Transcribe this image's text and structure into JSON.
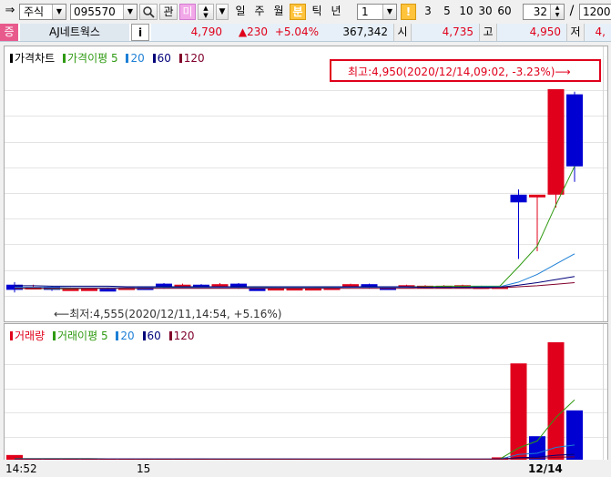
{
  "toolbar": {
    "market_select": "주식",
    "code_value": "095570",
    "btn_gwan": "관",
    "btn_ma": "미",
    "periods": [
      "일",
      "주",
      "월",
      "분",
      "틱",
      "년"
    ],
    "active_period": "분",
    "interval_value": "1",
    "interval_mark": "!",
    "intervals": [
      "3",
      "5",
      "10",
      "30",
      "60"
    ],
    "count_value": "32",
    "count_sep": "/",
    "count_total": "1200"
  },
  "quote": {
    "badge": "증",
    "name": "AJ네트웍스",
    "info": "i",
    "price": "4,790",
    "change": "▲230",
    "change_pct": "+5.04%",
    "volume": "367,342",
    "open_label": "시",
    "open_value": "4,735",
    "high_label": "고",
    "high_value": "4,950",
    "low_label": "저",
    "low_value": "4,"
  },
  "price_panel": {
    "legend_title": "가격차트",
    "legend_ma": "가격이평",
    "ma_periods": [
      "5",
      "20",
      "60",
      "120"
    ],
    "annotation_high": "최고:4,950(2020/12/14,09:02, -3.23%)⟶",
    "annotation_low": "⟵최저:4,555(2020/12/11,14:54, +5.16%)"
  },
  "volume_panel": {
    "legend_title": "거래량",
    "legend_ma": "거래이평",
    "ma_periods": [
      "5",
      "20",
      "60",
      "120"
    ]
  },
  "x_axis": {
    "labels": [
      "14:52",
      "15",
      "12/14"
    ]
  },
  "colors": {
    "up": "#e0001b",
    "down": "#0000d2",
    "ma5": "#2f9a12",
    "ma20": "#1d7fd6",
    "ma60": "#00007a",
    "ma120": "#80002a",
    "accent": "#ffc33c"
  },
  "chart_data": [
    {
      "type": "candlestick",
      "title": "가격차트",
      "y_range": [
        4520,
        4980
      ],
      "candles": [
        {
          "o": 4570,
          "h": 4575,
          "l": 4555,
          "c": 4560
        },
        {
          "o": 4565,
          "h": 4570,
          "l": 4562,
          "c": 4566
        },
        {
          "o": 4566,
          "h": 4567,
          "l": 4558,
          "c": 4560
        },
        {
          "o": 4562,
          "h": 4565,
          "l": 4560,
          "c": 4563
        },
        {
          "o": 4563,
          "h": 4564,
          "l": 4562,
          "c": 4563
        },
        {
          "o": 4562,
          "h": 4565,
          "l": 4560,
          "c": 4561
        },
        {
          "o": 4561,
          "h": 4566,
          "l": 4560,
          "c": 4565
        },
        {
          "o": 4565,
          "h": 4566,
          "l": 4560,
          "c": 4564
        },
        {
          "o": 4572,
          "h": 4573,
          "l": 4562,
          "c": 4566
        },
        {
          "o": 4566,
          "h": 4572,
          "l": 4565,
          "c": 4570
        },
        {
          "o": 4570,
          "h": 4571,
          "l": 4568,
          "c": 4569
        },
        {
          "o": 4566,
          "h": 4573,
          "l": 4565,
          "c": 4571
        },
        {
          "o": 4572,
          "h": 4573,
          "l": 4562,
          "c": 4563
        },
        {
          "o": 4563,
          "h": 4566,
          "l": 4558,
          "c": 4558
        },
        {
          "o": 4563,
          "h": 4565,
          "l": 4562,
          "c": 4564
        },
        {
          "o": 4564,
          "h": 4565,
          "l": 4563,
          "c": 4564
        },
        {
          "o": 4564,
          "h": 4565,
          "l": 4563,
          "c": 4564
        },
        {
          "o": 4564,
          "h": 4566,
          "l": 4563,
          "c": 4565
        },
        {
          "o": 4566,
          "h": 4572,
          "l": 4565,
          "c": 4571
        },
        {
          "o": 4571,
          "h": 4572,
          "l": 4563,
          "c": 4564
        },
        {
          "o": 4565,
          "h": 4566,
          "l": 4563,
          "c": 4564
        },
        {
          "o": 4566,
          "h": 4570,
          "l": 4565,
          "c": 4569
        },
        {
          "o": 4566,
          "h": 4569,
          "l": 4565,
          "c": 4568
        },
        {
          "o": 4568,
          "h": 4569,
          "l": 4565,
          "c": 4568
        },
        {
          "o": 4566,
          "h": 4570,
          "l": 4565,
          "c": 4569
        },
        {
          "o": 4566,
          "h": 4568,
          "l": 4565,
          "c": 4567
        },
        {
          "o": 4567,
          "h": 4568,
          "l": 4566,
          "c": 4567
        },
        {
          "o": 4745,
          "h": 4755,
          "l": 4620,
          "c": 4730
        },
        {
          "o": 4740,
          "h": 4742,
          "l": 4635,
          "c": 4745
        },
        {
          "o": 4745,
          "h": 4950,
          "l": 4720,
          "c": 4950
        },
        {
          "o": 4940,
          "h": 4945,
          "l": 4770,
          "c": 4800
        }
      ],
      "ma5": [
        4563,
        4563,
        4562,
        4562,
        4563,
        4563,
        4563,
        4563,
        4564,
        4565,
        4566,
        4566,
        4566,
        4565,
        4564,
        4564,
        4564,
        4565,
        4566,
        4566,
        4566,
        4566,
        4566,
        4567,
        4567,
        4567,
        4567,
        4605,
        4645,
        4725,
        4800
      ],
      "ma20": [
        4565,
        4565,
        4565,
        4564,
        4564,
        4564,
        4564,
        4564,
        4564,
        4564,
        4564,
        4564,
        4564,
        4564,
        4564,
        4564,
        4564,
        4564,
        4565,
        4565,
        4565,
        4565,
        4565,
        4565,
        4565,
        4566,
        4566,
        4575,
        4590,
        4610,
        4630
      ],
      "ma60": [
        4568,
        4568,
        4567,
        4567,
        4567,
        4567,
        4566,
        4566,
        4566,
        4566,
        4566,
        4566,
        4566,
        4566,
        4566,
        4566,
        4566,
        4566,
        4566,
        4566,
        4566,
        4566,
        4565,
        4565,
        4565,
        4565,
        4565,
        4569,
        4574,
        4580,
        4586
      ],
      "ma120": [
        4563,
        4563,
        4563,
        4563,
        4563,
        4563,
        4563,
        4563,
        4563,
        4563,
        4563,
        4563,
        4563,
        4563,
        4563,
        4563,
        4563,
        4563,
        4563,
        4563,
        4563,
        4563,
        4563,
        4563,
        4563,
        4563,
        4564,
        4566,
        4568,
        4571,
        4574
      ],
      "high": {
        "value": 4950,
        "time": "2020/12/14,09:02",
        "pct": "-3.23%"
      },
      "low": {
        "value": 4555,
        "time": "2020/12/11,14:54",
        "pct": "+5.16%"
      }
    },
    {
      "type": "bar",
      "title": "거래량",
      "y_range": [
        0,
        1000
      ],
      "volumes": [
        40,
        10,
        5,
        5,
        5,
        5,
        8,
        5,
        6,
        5,
        5,
        4,
        4,
        4,
        4,
        4,
        4,
        4,
        4,
        4,
        4,
        4,
        4,
        4,
        4,
        4,
        20,
        820,
        200,
        1000,
        420
      ],
      "up": [
        true,
        true,
        true,
        true,
        true,
        true,
        true,
        true,
        true,
        true,
        true,
        true,
        true,
        true,
        true,
        true,
        true,
        true,
        true,
        true,
        true,
        true,
        true,
        true,
        true,
        true,
        true,
        true,
        false,
        true,
        false
      ],
      "ma5": [
        10,
        10,
        10,
        10,
        10,
        8,
        7,
        6,
        6,
        6,
        5,
        5,
        5,
        5,
        5,
        4,
        4,
        4,
        4,
        4,
        4,
        4,
        4,
        4,
        4,
        4,
        6,
        100,
        160,
        360,
        510
      ],
      "ma20": [
        8,
        8,
        8,
        8,
        8,
        8,
        8,
        8,
        8,
        8,
        8,
        7,
        7,
        7,
        7,
        7,
        6,
        6,
        6,
        6,
        6,
        6,
        5,
        5,
        5,
        5,
        5,
        45,
        55,
        105,
        125
      ],
      "ma60": [
        6,
        6,
        6,
        6,
        6,
        6,
        6,
        6,
        6,
        6,
        6,
        6,
        6,
        6,
        6,
        6,
        6,
        6,
        6,
        6,
        6,
        6,
        6,
        6,
        6,
        6,
        6,
        18,
        22,
        38,
        46
      ],
      "ma120": [
        5,
        5,
        5,
        5,
        5,
        5,
        5,
        5,
        5,
        5,
        5,
        5,
        5,
        5,
        5,
        5,
        5,
        5,
        5,
        5,
        5,
        5,
        5,
        5,
        5,
        5,
        5,
        10,
        12,
        20,
        24
      ]
    }
  ]
}
